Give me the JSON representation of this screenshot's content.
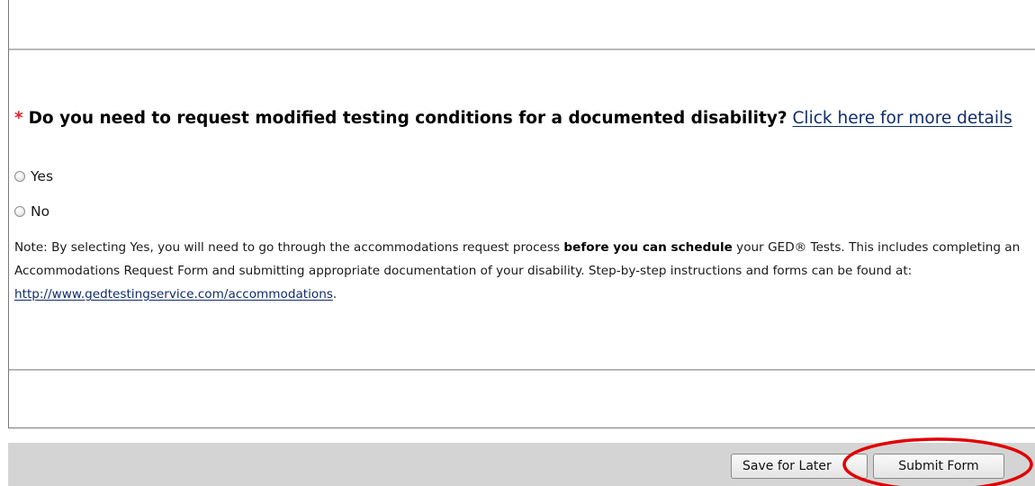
{
  "question": {
    "required_marker": "*",
    "text": "Do you need to request modified testing conditions for a documented disability?",
    "link_text": "Click here for more details"
  },
  "options": [
    {
      "label": "Yes",
      "selected": false
    },
    {
      "label": "No",
      "selected": false
    }
  ],
  "note": {
    "part1": "Note: By selecting Yes, you will need to go through the accommodations request process ",
    "bold": "before you can schedule",
    "part2": " your GED® Tests. This includes completing an Accommodations Request Form and submitting appropriate documentation of your disability. Step-by-step instructions and forms can be found at: ",
    "link_text": "http://www.gedtestingservice.com/accommodations",
    "part3": "."
  },
  "footer": {
    "save_label": "Save for Later",
    "submit_label": "Submit Form"
  },
  "colors": {
    "required": "#e8242d",
    "link": "#0f2c6b",
    "highlight": "#e00000",
    "footer_bg": "#d4d4d4"
  }
}
